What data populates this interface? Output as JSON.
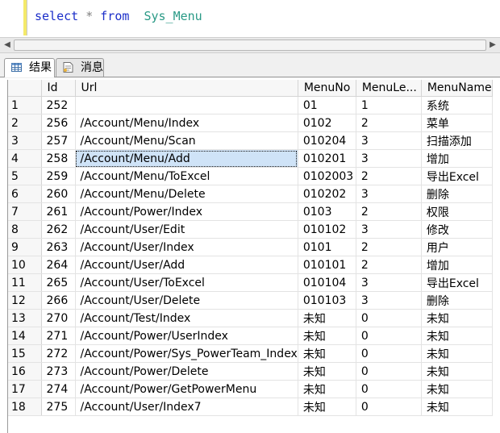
{
  "query": {
    "keyword_select": "select",
    "star": "*",
    "keyword_from": "from",
    "table_name": "Sys_Menu"
  },
  "scrollbar": {
    "left_arrow": "◀",
    "right_arrow": "▶"
  },
  "tabs": [
    {
      "label": "结果",
      "icon": "results-grid-icon"
    },
    {
      "label": "消息",
      "icon": "messages-icon"
    }
  ],
  "grid": {
    "columns": [
      "Id",
      "Url",
      "MenuNo",
      "MenuLe...",
      "MenuName"
    ],
    "selected_row": 4,
    "selected_column": "Url",
    "rows": [
      {
        "n": "1",
        "id": "252",
        "url": "",
        "no": "01",
        "lv": "1",
        "name": "系统"
      },
      {
        "n": "2",
        "id": "256",
        "url": "/Account/Menu/Index",
        "no": "0102",
        "lv": "2",
        "name": "菜单"
      },
      {
        "n": "3",
        "id": "257",
        "url": "/Account/Menu/Scan",
        "no": "010204",
        "lv": "3",
        "name": "扫描添加"
      },
      {
        "n": "4",
        "id": "258",
        "url": "/Account/Menu/Add",
        "no": "010201",
        "lv": "3",
        "name": "增加"
      },
      {
        "n": "5",
        "id": "259",
        "url": "/Account/Menu/ToExcel",
        "no": "0102003",
        "lv": "2",
        "name": "导出Excel"
      },
      {
        "n": "6",
        "id": "260",
        "url": "/Account/Menu/Delete",
        "no": "010202",
        "lv": "3",
        "name": "删除"
      },
      {
        "n": "7",
        "id": "261",
        "url": "/Account/Power/Index",
        "no": "0103",
        "lv": "2",
        "name": "权限"
      },
      {
        "n": "8",
        "id": "262",
        "url": "/Account/User/Edit",
        "no": "010102",
        "lv": "3",
        "name": "修改"
      },
      {
        "n": "9",
        "id": "263",
        "url": "/Account/User/Index",
        "no": "0101",
        "lv": "2",
        "name": "用户"
      },
      {
        "n": "10",
        "id": "264",
        "url": "/Account/User/Add",
        "no": "010101",
        "lv": "2",
        "name": "增加"
      },
      {
        "n": "11",
        "id": "265",
        "url": "/Account/User/ToExcel",
        "no": "010104",
        "lv": "3",
        "name": "导出Excel"
      },
      {
        "n": "12",
        "id": "266",
        "url": "/Account/User/Delete",
        "no": "010103",
        "lv": "3",
        "name": "删除"
      },
      {
        "n": "13",
        "id": "270",
        "url": "/Account/Test/Index",
        "no": "未知",
        "lv": "0",
        "name": "未知"
      },
      {
        "n": "14",
        "id": "271",
        "url": "/Account/Power/UserIndex",
        "no": "未知",
        "lv": "0",
        "name": "未知"
      },
      {
        "n": "15",
        "id": "272",
        "url": "/Account/Power/Sys_PowerTeam_Index",
        "no": "未知",
        "lv": "0",
        "name": "未知"
      },
      {
        "n": "16",
        "id": "273",
        "url": "/Account/Power/Delete",
        "no": "未知",
        "lv": "0",
        "name": "未知"
      },
      {
        "n": "17",
        "id": "274",
        "url": "/Account/Power/GetPowerMenu",
        "no": "未知",
        "lv": "0",
        "name": "未知"
      },
      {
        "n": "18",
        "id": "275",
        "url": "/Account/User/Index7",
        "no": "未知",
        "lv": "0",
        "name": "未知"
      }
    ]
  }
}
